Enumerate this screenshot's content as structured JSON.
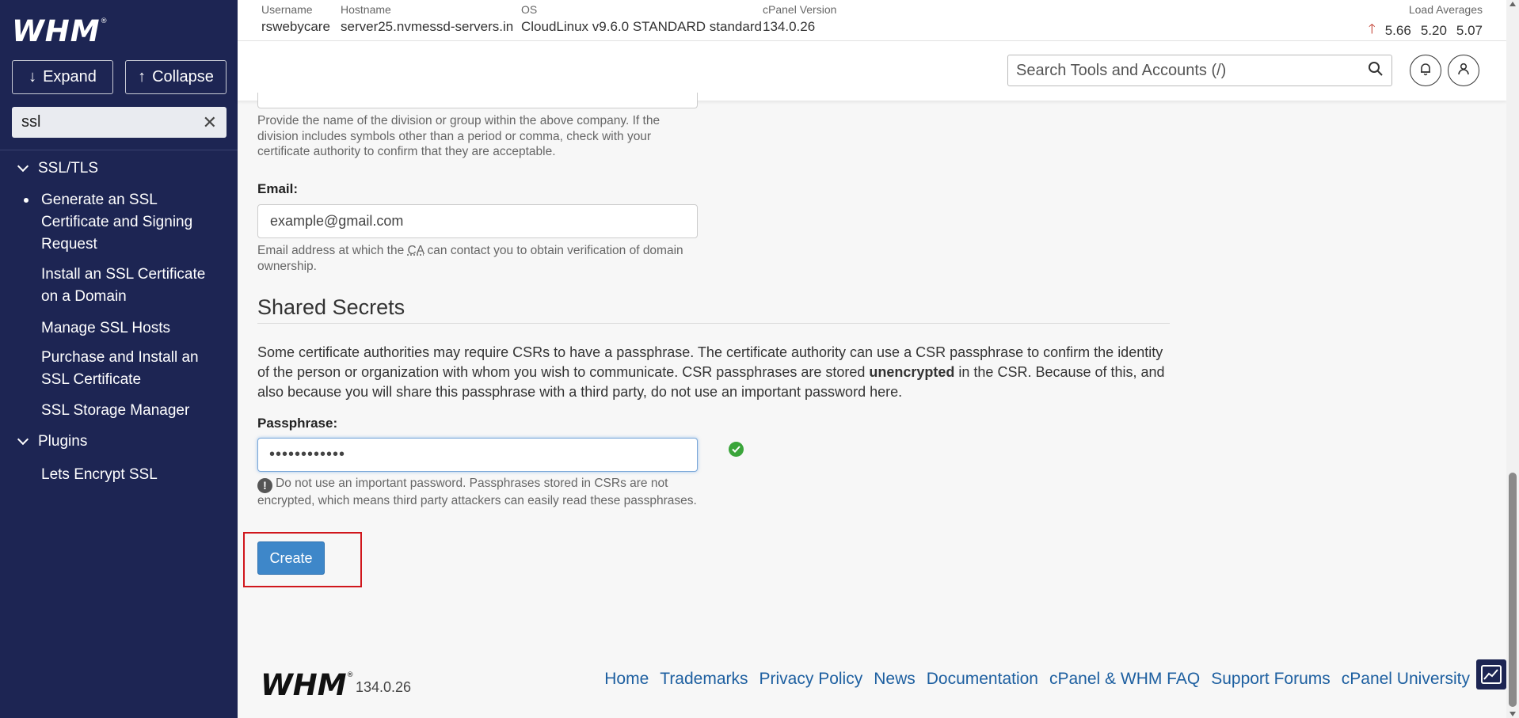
{
  "app": {
    "logo_text": "WHM",
    "logo_mark": "®"
  },
  "sidebar": {
    "expand_label": "Expand",
    "collapse_label": "Collapse",
    "search_value": "ssl",
    "categories": [
      {
        "label": "SSL/TLS",
        "items": [
          {
            "label": "Generate an SSL Certificate and Signing Request",
            "active": true
          },
          {
            "label": "Install an SSL Certificate on a Domain",
            "active": false
          },
          {
            "label": "Manage SSL Hosts",
            "active": false
          },
          {
            "label": "Purchase and Install an SSL Certificate",
            "active": false
          },
          {
            "label": "SSL Storage Manager",
            "active": false
          }
        ]
      },
      {
        "label": "Plugins",
        "items": [
          {
            "label": "Lets Encrypt SSL",
            "active": false
          }
        ]
      }
    ]
  },
  "header": {
    "username_label": "Username",
    "username": "rswebycare",
    "hostname_label": "Hostname",
    "hostname": "server25.nvmessd-servers.in",
    "os_label": "OS",
    "os": "CloudLinux v9.6.0 STANDARD standard",
    "cpanel_label": "cPanel Version",
    "cpanel_version": "134.0.26",
    "load_label": "Load Averages",
    "loads": [
      "5.66",
      "5.20",
      "5.07"
    ],
    "load_trend_color": "#c0392b"
  },
  "toolbar": {
    "search_placeholder": "Search Tools and Accounts (/)"
  },
  "form": {
    "division_help": "Provide the name of the division or group within the above company. If the division includes symbols other than a period or comma, check with your certificate authority to confirm that they are acceptable.",
    "email_label": "Email:",
    "email_value": "example@gmail.com",
    "email_help_pre": "Email address at which the ",
    "email_help_abbr": "CA",
    "email_help_post": " can contact you to obtain verification of domain ownership.",
    "secrets_title": "Shared Secrets",
    "secrets_para_pre": "Some certificate authorities may require CSRs to have a passphrase. The certificate authority can use a CSR passphrase to confirm the identity of the person or organization with whom you wish to communicate. CSR passphrases are stored ",
    "secrets_para_bold": "unencrypted",
    "secrets_para_post": " in the CSR. Because of this, and also because you will share this passphrase with a third party, do not use an important password here.",
    "passphrase_label": "Passphrase:",
    "passphrase_value": "••••••••••••",
    "passphrase_warning": "Do not use an important password. Passphrases stored in CSRs are not encrypted, which means third party attackers can easily read these passphrases.",
    "create_label": "Create",
    "accent_color": "#3e87c9",
    "highlight_color": "#d0161c",
    "valid_color": "#3aa53a"
  },
  "footer": {
    "logo_text": "WHM",
    "logo_mark": "®",
    "version": "134.0.26",
    "links": [
      "Home",
      "Trademarks",
      "Privacy Policy",
      "News",
      "Documentation",
      "cPanel & WHM FAQ",
      "Support Forums",
      "cPanel University"
    ]
  }
}
